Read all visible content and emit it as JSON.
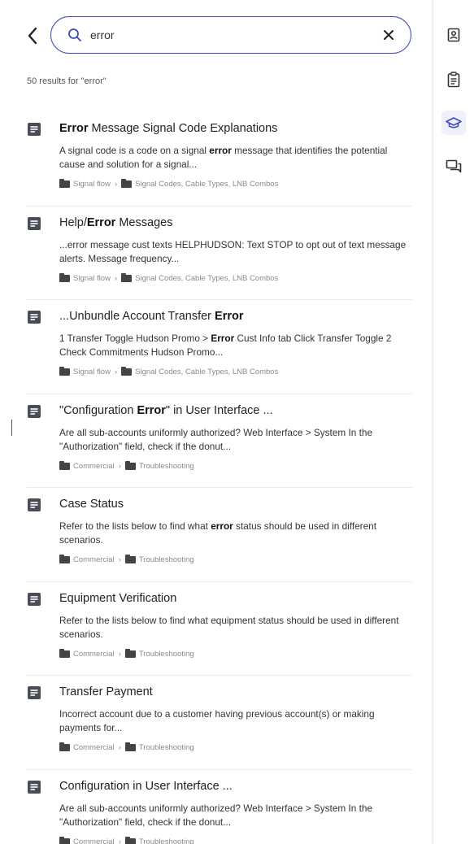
{
  "search": {
    "query": "error"
  },
  "results_count": "50 results for \"error\"",
  "results": [
    {
      "title": [
        {
          "b": true,
          "t": "Error"
        },
        {
          "b": false,
          "t": " Message Signal Code Explanations"
        }
      ],
      "snippet": [
        {
          "b": false,
          "t": "A signal code is a code on a signal "
        },
        {
          "b": true,
          "t": "error"
        },
        {
          "b": false,
          "t": " message that identifies the potential cause and solution for a signal..."
        }
      ],
      "crumbs": [
        "Signal flow",
        "Signal Codes, Cable Types, LNB Combos"
      ]
    },
    {
      "title": [
        {
          "b": false,
          "t": "Help/"
        },
        {
          "b": true,
          "t": "Error"
        },
        {
          "b": false,
          "t": " Messages"
        }
      ],
      "snippet": [
        {
          "b": false,
          "t": "...error message cust texts HELPHUDSON: Text STOP to opt out of text message alerts. Message frequency..."
        }
      ],
      "crumbs": [
        "Signal flow",
        "Signal Codes, Cable Types, LNB Combos"
      ]
    },
    {
      "title": [
        {
          "b": false,
          "t": "...Unbundle Account Transfer "
        },
        {
          "b": true,
          "t": "Error"
        }
      ],
      "snippet": [
        {
          "b": false,
          "t": "1 Transfer Toggle Hudson Promo > "
        },
        {
          "b": true,
          "t": "Error"
        },
        {
          "b": false,
          "t": " Cust Info tab Click Transfer Toggle  2 Check Commitments Hudson Promo..."
        }
      ],
      "crumbs": [
        "Signal flow",
        "Signal Codes, Cable Types, LNB Combos"
      ]
    },
    {
      "title": [
        {
          "b": false,
          "t": "\"Configuration "
        },
        {
          "b": true,
          "t": "Error"
        },
        {
          "b": false,
          "t": "\" in User Interface ..."
        }
      ],
      "snippet": [
        {
          "b": false,
          "t": "Are all sub-accounts uniformly authorized?  Web Interface > System In the \"Authorization\" field, check if the donut..."
        }
      ],
      "crumbs": [
        "Commercial",
        "Troubleshooting"
      ]
    },
    {
      "title": [
        {
          "b": false,
          "t": "Case Status"
        }
      ],
      "snippet": [
        {
          "b": false,
          "t": "Refer to the lists below to find what "
        },
        {
          "b": true,
          "t": "error"
        },
        {
          "b": false,
          "t": " status should be used in different scenarios."
        }
      ],
      "crumbs": [
        "Commercial",
        "Troubleshooting"
      ]
    },
    {
      "title": [
        {
          "b": false,
          "t": "Equipment Verification"
        }
      ],
      "snippet": [
        {
          "b": false,
          "t": "Refer to the lists below to find what equipment status should be used in different scenarios."
        }
      ],
      "crumbs": [
        "Commercial",
        "Troubleshooting"
      ]
    },
    {
      "title": [
        {
          "b": false,
          "t": "Transfer Payment"
        }
      ],
      "snippet": [
        {
          "b": false,
          "t": "Incorrect account due to a customer having previous account(s) or making payments for..."
        }
      ],
      "crumbs": [
        "Commercial",
        "Troubleshooting"
      ]
    },
    {
      "title": [
        {
          "b": false,
          "t": "Configuration in User Interface ..."
        }
      ],
      "snippet": [
        {
          "b": false,
          "t": "Are all sub-accounts uniformly authorized?  Web Interface > System In the \"Authorization\" field, check if the donut..."
        }
      ],
      "crumbs": [
        "Commercial",
        "Troubleshooting"
      ]
    }
  ],
  "rail": [
    {
      "icon": "contact-card-icon",
      "active": false
    },
    {
      "icon": "clipboard-icon",
      "active": false
    },
    {
      "icon": "graduation-cap-icon",
      "active": true
    },
    {
      "icon": "chat-bubbles-icon",
      "active": false
    }
  ],
  "colors": {
    "accent": "#3d4db5",
    "doc_icon": "#4a4d57"
  }
}
